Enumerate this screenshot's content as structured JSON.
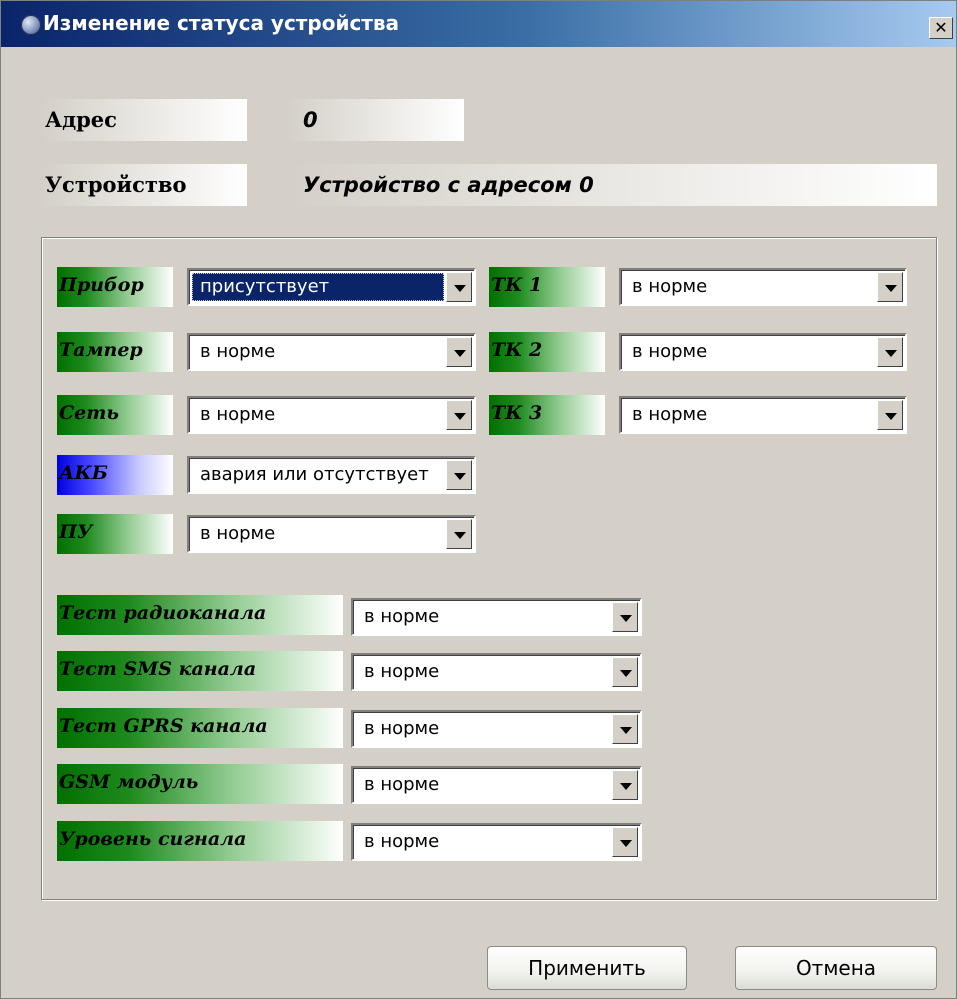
{
  "window": {
    "title": "Изменение статуса устройства",
    "close_label": "✕"
  },
  "header": {
    "address_label": "Адрес",
    "address_value": "0",
    "device_label": "Устройство",
    "device_value": "Устройство с адресом 0"
  },
  "left_fields": [
    {
      "label": "Прибор",
      "value": "присутствует"
    },
    {
      "label": "Тампер",
      "value": "в норме"
    },
    {
      "label": "Сеть",
      "value": "в норме"
    },
    {
      "label": "АКБ",
      "value": "авария или отсутствует"
    },
    {
      "label": "ПУ",
      "value": "в норме"
    }
  ],
  "right_fields": [
    {
      "label": "ТК 1",
      "value": "в норме"
    },
    {
      "label": "ТК 2",
      "value": "в норме"
    },
    {
      "label": "ТК 3",
      "value": "в норме"
    }
  ],
  "test_fields": [
    {
      "label": "Тест радиоканала",
      "value": "в норме"
    },
    {
      "label": "Тест SMS канала",
      "value": "в норме"
    },
    {
      "label": "Тест GPRS канала",
      "value": "в норме"
    },
    {
      "label": "GSM модуль",
      "value": "в норме"
    },
    {
      "label": "Уровень сигнала",
      "value": "в норме"
    }
  ],
  "buttons": {
    "apply": "Применить",
    "cancel": "Отмена"
  },
  "colors": {
    "label_green": "#007000",
    "label_blue": "#0000e0",
    "selection": "#0a246a",
    "titlebar": "#0a246a"
  }
}
